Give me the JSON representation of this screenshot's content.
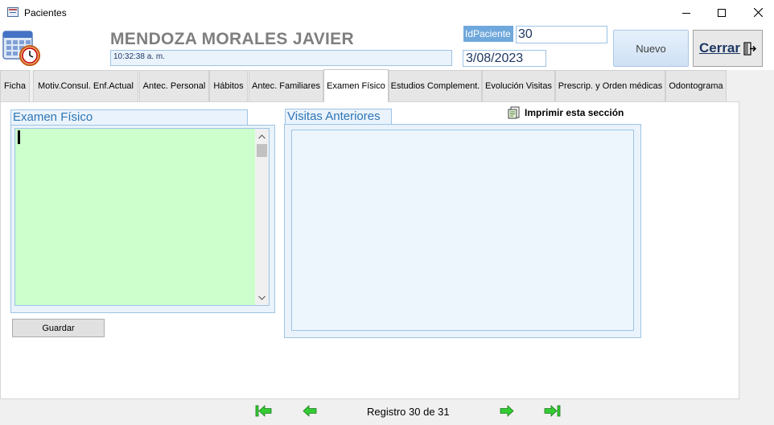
{
  "window": {
    "title": "Pacientes",
    "minimize_icon": "minimize-icon",
    "maximize_icon": "maximize-icon",
    "close_icon": "close-icon"
  },
  "header": {
    "app_icon": "calendar-clock-icon",
    "patient_name": "MENDOZA MORALES JAVIER",
    "time": "10:32:38 a. m.",
    "id_label": "IdPaciente",
    "id_value": "30",
    "date": "3/08/2023",
    "nuevo_label": "Nuevo",
    "cerrar_label": "Cerrar",
    "cerrar_icon": "exit-door-icon"
  },
  "tabs": [
    {
      "label": "Ficha"
    },
    {
      "label": "Motiv.Consul. Enf.Actual"
    },
    {
      "label": "Antec. Personal"
    },
    {
      "label": "Hábitos"
    },
    {
      "label": "Antec. Familiares"
    },
    {
      "label": "Examen Físico",
      "active": true
    },
    {
      "label": "Estudios Complement."
    },
    {
      "label": "Evolución Visitas"
    },
    {
      "label": "Prescrip. y Orden médicas"
    },
    {
      "label": "Odontograma"
    }
  ],
  "exam": {
    "label": "Examen Físico",
    "value": "",
    "save_label": "Guardar"
  },
  "visits": {
    "label": "Visitas Anteriores",
    "print_label": "Imprimir esta sección",
    "print_icon": "print-report-icon"
  },
  "nav": {
    "record_text": "Registro 30 de 31",
    "first_icon": "first-record-icon",
    "prev_icon": "previous-record-icon",
    "next_icon": "next-record-icon",
    "last_icon": "last-record-icon",
    "arrow_color": "#33cc33"
  }
}
